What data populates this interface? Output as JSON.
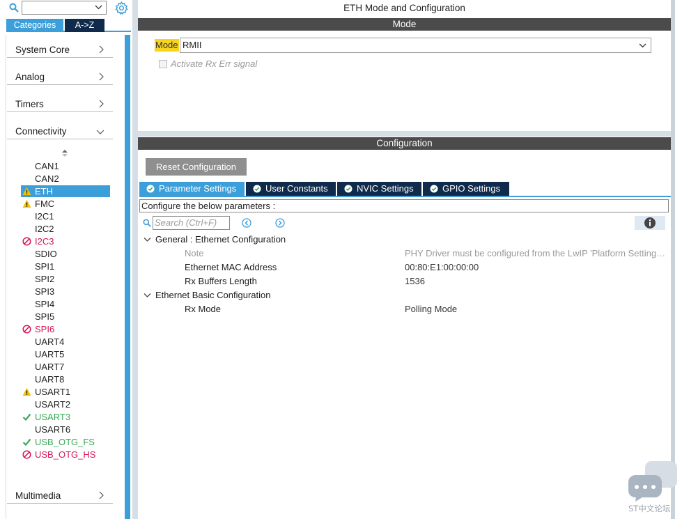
{
  "left": {
    "tabs": [
      "Categories",
      "A->Z"
    ],
    "categories": [
      {
        "label": "System Core",
        "expanded": false
      },
      {
        "label": "Analog",
        "expanded": false
      },
      {
        "label": "Timers",
        "expanded": false
      },
      {
        "label": "Connectivity",
        "expanded": true
      },
      {
        "label": "Multimedia",
        "expanded": false
      }
    ],
    "peripherals": [
      {
        "name": "CAN1",
        "status": "none"
      },
      {
        "name": "CAN2",
        "status": "none"
      },
      {
        "name": "ETH",
        "status": "warning",
        "selected": true
      },
      {
        "name": "FMC",
        "status": "warning"
      },
      {
        "name": "I2C1",
        "status": "none"
      },
      {
        "name": "I2C2",
        "status": "none"
      },
      {
        "name": "I2C3",
        "status": "disabled"
      },
      {
        "name": "SDIO",
        "status": "none"
      },
      {
        "name": "SPI1",
        "status": "none"
      },
      {
        "name": "SPI2",
        "status": "none"
      },
      {
        "name": "SPI3",
        "status": "none"
      },
      {
        "name": "SPI4",
        "status": "none"
      },
      {
        "name": "SPI5",
        "status": "none"
      },
      {
        "name": "SPI6",
        "status": "disabled"
      },
      {
        "name": "UART4",
        "status": "none"
      },
      {
        "name": "UART5",
        "status": "none"
      },
      {
        "name": "UART7",
        "status": "none"
      },
      {
        "name": "UART8",
        "status": "none"
      },
      {
        "name": "USART1",
        "status": "warning"
      },
      {
        "name": "USART2",
        "status": "none"
      },
      {
        "name": "USART3",
        "status": "ok"
      },
      {
        "name": "USART6",
        "status": "none"
      },
      {
        "name": "USB_OTG_FS",
        "status": "ok"
      },
      {
        "name": "USB_OTG_HS",
        "status": "disabled"
      }
    ]
  },
  "main": {
    "title": "ETH Mode and Configuration",
    "mode_section": "Mode",
    "mode_label": "Mode",
    "mode_value": "RMII",
    "rx_err_label": "Activate Rx Err signal",
    "config_section": "Configuration",
    "reset_button": "Reset Configuration",
    "tabs": [
      "Parameter Settings",
      "User Constants",
      "NVIC Settings",
      "GPIO Settings"
    ],
    "configure_text": "Configure the below parameters :",
    "search_placeholder": "Search (Ctrl+F)",
    "groups": [
      {
        "label": "General : Ethernet Configuration",
        "params": [
          {
            "name": "Note",
            "value": "PHY Driver must be configured from the LwIP 'Platform Settings' top right menu",
            "muted": true
          },
          {
            "name": "Ethernet MAC Address",
            "value": "00:80:E1:00:00:00"
          },
          {
            "name": "Rx Buffers Length",
            "value": "1536"
          }
        ]
      },
      {
        "label": "Ethernet Basic Configuration",
        "params": [
          {
            "name": "Rx Mode",
            "value": "Polling Mode"
          }
        ]
      }
    ]
  },
  "watermark": "ST中文论坛",
  "colors": {
    "accent": "#3c9fd9",
    "dark_tab": "#0f2a4a",
    "section_bar": "#4b4b4b",
    "mode_highlight": "#f9d41e",
    "warning": "#f2c200",
    "error": "#d4145a",
    "ok": "#3aa757"
  }
}
